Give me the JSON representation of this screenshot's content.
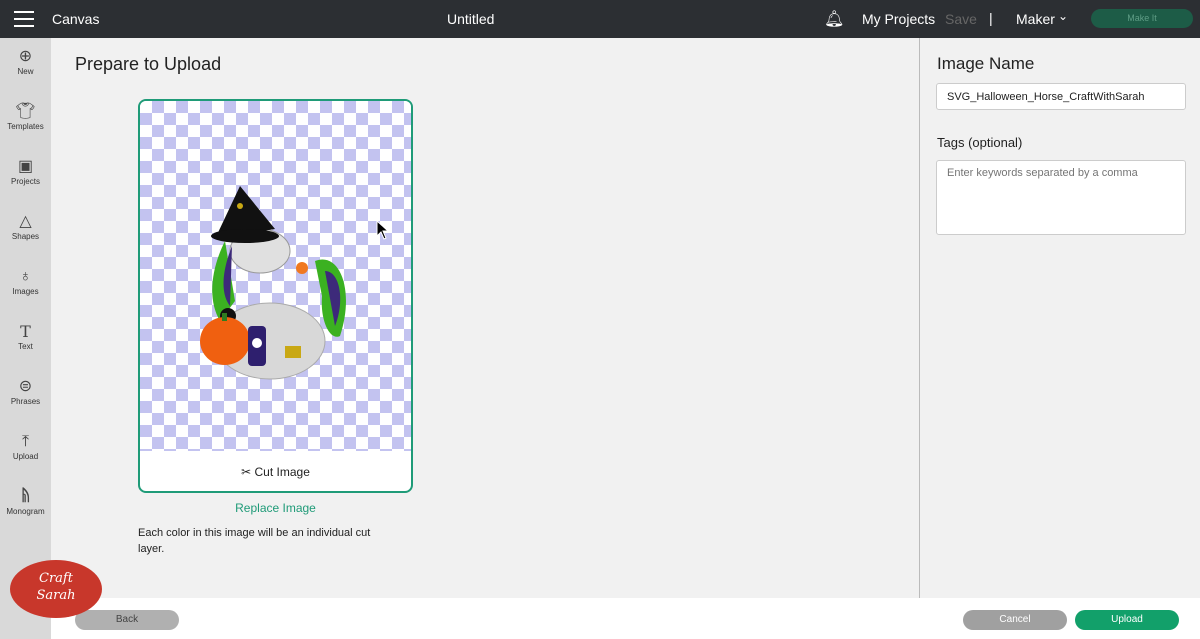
{
  "header": {
    "app_name": "Canvas",
    "document_title": "Untitled",
    "my_projects": "My Projects",
    "save": "Save",
    "separator": "|",
    "machine": "Maker",
    "make_it": "Make It",
    "make_it_color": "#1d5c47"
  },
  "sidebar": {
    "items": [
      {
        "label": "New",
        "icon": "plus-circle-icon"
      },
      {
        "label": "Templates",
        "icon": "shirt-icon"
      },
      {
        "label": "Projects",
        "icon": "projects-icon"
      },
      {
        "label": "Shapes",
        "icon": "shapes-icon"
      },
      {
        "label": "Images",
        "icon": "lightbulb-icon"
      },
      {
        "label": "Text",
        "icon": "text-icon"
      },
      {
        "label": "Phrases",
        "icon": "speech-bubble-icon"
      },
      {
        "label": "Upload",
        "icon": "upload-icon"
      },
      {
        "label": "Monogram",
        "icon": "monogram-icon"
      }
    ]
  },
  "main": {
    "title": "Prepare to Upload",
    "cut_image": "Cut Image",
    "replace_image": "Replace Image",
    "note": "Each color in this image will be an individual cut layer."
  },
  "right": {
    "image_name_label": "Image Name",
    "image_name_value": "SVG_Halloween_Horse_CraftWithSarah",
    "tags_label": "Tags (optional)",
    "tags_placeholder": "Enter keywords separated by a comma"
  },
  "footer": {
    "back": "Back",
    "cancel": "Cancel",
    "upload": "Upload",
    "accent": "#12a06a"
  },
  "watermark": {
    "text": "Craft with Sarah"
  }
}
